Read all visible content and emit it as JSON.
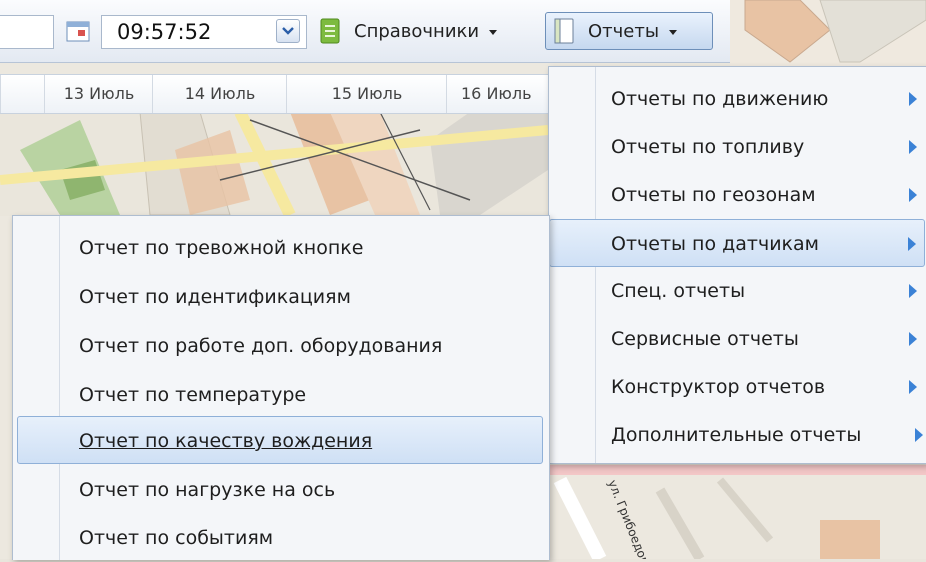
{
  "toolbar": {
    "time_value": "09:57:52",
    "reference_label": "Справочники",
    "reports_label": "Отчеты"
  },
  "timeline": {
    "days": [
      "13 Июль",
      "14 Июль",
      "15 Июль",
      "16 Июль"
    ]
  },
  "reports_menu": {
    "items": [
      {
        "label": "Отчеты по движению"
      },
      {
        "label": "Отчеты по топливу"
      },
      {
        "label": "Отчеты по геозонам"
      },
      {
        "label": "Отчеты по датчикам"
      },
      {
        "label": "Спец. отчеты"
      },
      {
        "label": "Сервисные отчеты"
      },
      {
        "label": "Конструктор отчетов"
      },
      {
        "label": "Дополнительные отчеты"
      }
    ],
    "highlighted": "Отчеты по датчикам"
  },
  "sensor_submenu": {
    "items": [
      {
        "label": "Отчет по тревожной кнопке"
      },
      {
        "label": "Отчет по идентификациям"
      },
      {
        "label": "Отчет по работе доп. оборудования"
      },
      {
        "label": "Отчет по температуре"
      },
      {
        "label": "Отчет по качеству вождения"
      },
      {
        "label": "Отчет по нагрузке на ось"
      },
      {
        "label": "Отчет по событиям"
      }
    ],
    "highlighted": "Отчет по качеству вождения"
  },
  "map": {
    "street_label": "ул. Грибоедова"
  },
  "colors": {
    "menu_highlight": "#cfe0f5",
    "submenu_arrow": "#3b82d6",
    "map_building": "#e8c3a4"
  },
  "icons": [
    "calendar-icon",
    "chevron-down-icon",
    "reference-book-icon",
    "reports-book-icon",
    "submenu-arrow-icon"
  ]
}
